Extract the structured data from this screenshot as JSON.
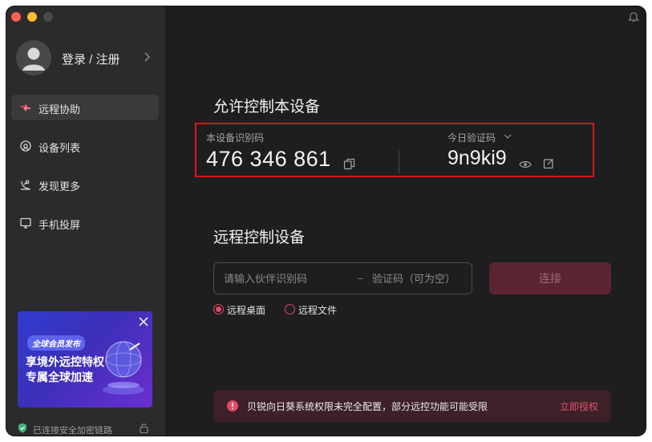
{
  "user": {
    "login_label": "登录 / 注册"
  },
  "nav": {
    "items": [
      {
        "label": "远程协助",
        "icon": "remote-assist-icon",
        "active": true
      },
      {
        "label": "设备列表",
        "icon": "device-list-icon",
        "active": false
      },
      {
        "label": "发现更多",
        "icon": "discover-icon",
        "active": false
      },
      {
        "label": "手机投屏",
        "icon": "screen-cast-icon",
        "active": false
      }
    ]
  },
  "promo": {
    "badge": "全球会员发布",
    "title_line1": "享境外远控特权",
    "title_line2": "专属全球加速"
  },
  "status": {
    "label": "已连接安全加密链路"
  },
  "allow_section": {
    "title": "允许控制本设备",
    "device_id_label": "本设备识别码",
    "device_id": "476 346 861",
    "code_label": "今日验证码",
    "code": "9n9ki9"
  },
  "remote_section": {
    "title": "远程控制设备",
    "partner_placeholder": "请输入伙伴识别码",
    "code_placeholder": "验证码（可为空）",
    "connect_label": "连接",
    "radio_options": [
      {
        "label": "远程桌面",
        "checked": true
      },
      {
        "label": "远程文件",
        "checked": false
      }
    ]
  },
  "alert": {
    "text": "贝锐向日葵系统权限未完全配置，部分远控功能可能受限",
    "action": "立即授权"
  },
  "colors": {
    "accent": "#e04a64",
    "highlight_border": "#d81818",
    "sidebar_bg": "#2b2b2d",
    "main_bg": "#1e1e20"
  }
}
